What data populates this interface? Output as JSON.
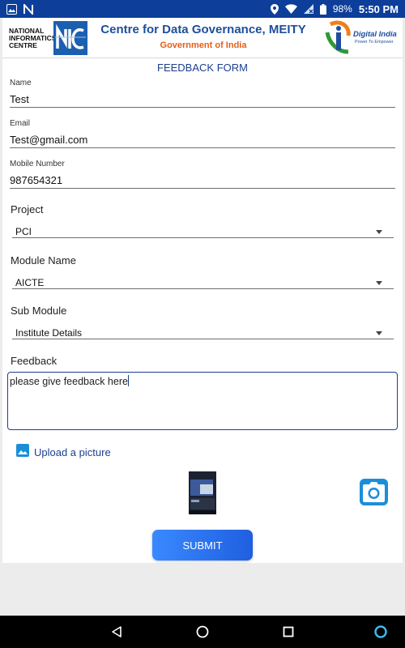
{
  "status_bar": {
    "time": "5:50 PM",
    "battery": "98%",
    "left_icons": [
      "photo-icon",
      "n-badge-icon"
    ],
    "right_icons": [
      "location-icon",
      "wifi-icon",
      "no-sim-icon",
      "battery-icon"
    ]
  },
  "header": {
    "nic_logo_text": "NATIONAL INFORMATICS CENTRE",
    "title": "Centre for Data Governance, MEITY",
    "subtitle": "Government of India",
    "digital_india_text": "Digital India",
    "digital_india_tagline": "Power To Empower"
  },
  "form": {
    "title": "FEEDBACK FORM",
    "name": {
      "label": "Name",
      "value": "Test"
    },
    "email": {
      "label": "Email",
      "value": "Test@gmail.com"
    },
    "mobile": {
      "label": "Mobile Number",
      "value": "987654321"
    },
    "project": {
      "label": "Project",
      "selected": "PCI"
    },
    "module": {
      "label": "Module Name",
      "selected": "AICTE"
    },
    "submodule": {
      "label": "Sub Module",
      "selected": "Institute Details"
    },
    "feedback": {
      "label": "Feedback",
      "value": "please give feedback here"
    },
    "upload_label": "Upload a picture",
    "submit_label": "SUBMIT"
  },
  "colors": {
    "status_bar": "#0d3f9a",
    "title_blue": "#1d4f9b",
    "subtitle_orange": "#e85d18",
    "accent": "#1d3f8f",
    "camera": "#1a8fd9",
    "submit_start": "#3a89ff",
    "submit_end": "#1f5fe0"
  },
  "nav_bar": {
    "icons": [
      "back-icon",
      "home-icon",
      "recents-icon",
      "assistant-icon"
    ]
  }
}
